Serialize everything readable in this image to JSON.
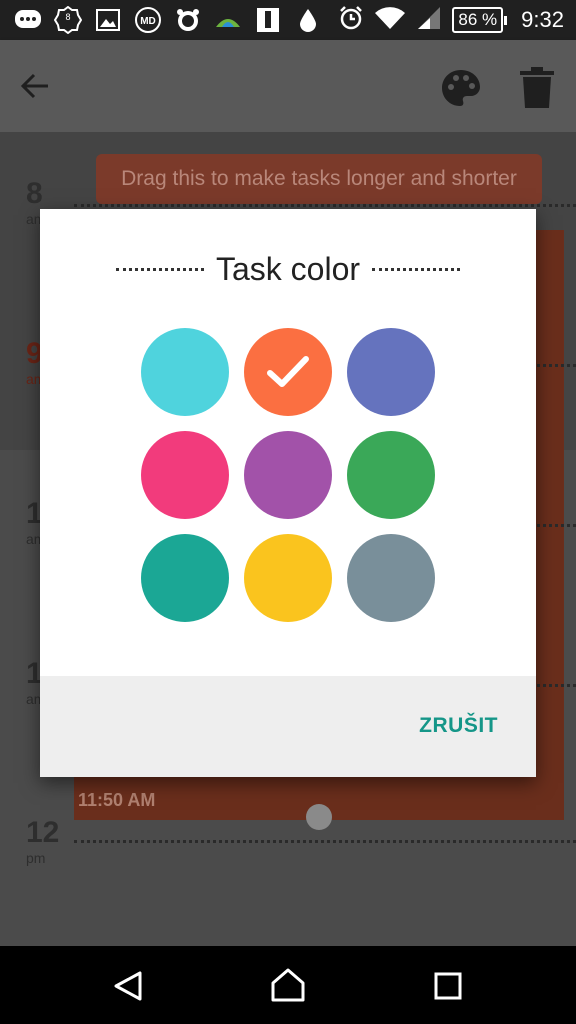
{
  "status_bar": {
    "battery": "86 %",
    "time": "9:32",
    "icons": [
      "message-icon",
      "badge-8-icon",
      "image-icon",
      "md-app-icon",
      "alarm-app-icon",
      "weather-icon",
      "phone-icon",
      "drop-icon",
      "alarm-clock-icon",
      "wifi-icon",
      "signal-icon"
    ],
    "badge_number": "8"
  },
  "app_bar": {
    "back_icon": "arrow-left-icon",
    "palette_icon": "palette-icon",
    "delete_icon": "trash-icon"
  },
  "background": {
    "tooltip": "Drag this to make tasks longer and shorter",
    "hours": [
      {
        "hour": "8",
        "suffix": "am"
      },
      {
        "hour": "9",
        "suffix": "am"
      },
      {
        "hour": "1",
        "suffix": "am"
      },
      {
        "hour": "1",
        "suffix": "am"
      },
      {
        "hour": "12",
        "suffix": "pm"
      }
    ],
    "task_end_time": "11:50 AM"
  },
  "dialog": {
    "title": "Task color",
    "colors": [
      {
        "name": "cyan",
        "hex": "#4fd3dd",
        "selected": false
      },
      {
        "name": "orange",
        "hex": "#fb6f41",
        "selected": true
      },
      {
        "name": "indigo",
        "hex": "#6573be",
        "selected": false
      },
      {
        "name": "pink",
        "hex": "#f23b7c",
        "selected": false
      },
      {
        "name": "purple",
        "hex": "#a252a9",
        "selected": false
      },
      {
        "name": "green",
        "hex": "#3aa858",
        "selected": false
      },
      {
        "name": "teal",
        "hex": "#1ba795",
        "selected": false
      },
      {
        "name": "yellow",
        "hex": "#fac41e",
        "selected": false
      },
      {
        "name": "blue-grey",
        "hex": "#798f9a",
        "selected": false
      }
    ],
    "cancel_label": "ZRUŠIT",
    "accent": "#159688"
  },
  "nav_bar": {
    "back_icon": "nav-back-icon",
    "home_icon": "nav-home-icon",
    "recents_icon": "nav-recents-icon"
  }
}
